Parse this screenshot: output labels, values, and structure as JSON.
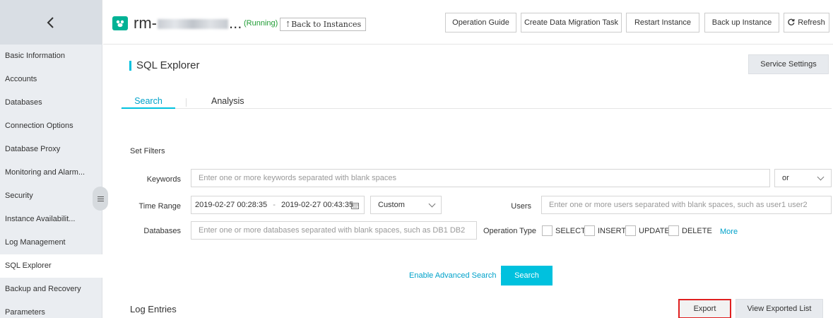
{
  "sidebar": {
    "items": [
      {
        "label": "Basic Information"
      },
      {
        "label": "Accounts"
      },
      {
        "label": "Databases"
      },
      {
        "label": "Connection Options"
      },
      {
        "label": "Database Proxy"
      },
      {
        "label": "Monitoring and Alarm..."
      },
      {
        "label": "Security"
      },
      {
        "label": "Instance Availabilit..."
      },
      {
        "label": "Log Management"
      },
      {
        "label": "SQL Explorer"
      },
      {
        "label": "Backup and Recovery"
      },
      {
        "label": "Parameters"
      }
    ],
    "active_item": "SQL Explorer"
  },
  "header": {
    "instance_prefix": "rm-",
    "instance_suffix": "...",
    "status": "(Running)",
    "back_to_instances": "⇡Back to Instances",
    "buttons": {
      "operation_guide": "Operation Guide",
      "create_migration": "Create Data Migration Task",
      "restart": "Restart Instance",
      "backup": "Back up Instance",
      "refresh": "Refresh"
    }
  },
  "page": {
    "title": "SQL Explorer",
    "service_settings": "Service Settings"
  },
  "tabs": [
    {
      "label": "Search"
    },
    {
      "label": "Analysis"
    }
  ],
  "active_tab": "Search",
  "filters": {
    "heading": "Set Filters",
    "keywords": {
      "label": "Keywords",
      "placeholder": "Enter one or more keywords separated with blank spaces",
      "logic_value": "or"
    },
    "time_range": {
      "label": "Time Range",
      "start": "2019-02-27 00:28:35",
      "separator": "-",
      "end": "2019-02-27 00:43:35",
      "mode": "Custom"
    },
    "users": {
      "label": "Users",
      "placeholder": "Enter one or more users separated with blank spaces, such as user1 user2"
    },
    "databases": {
      "label": "Databases",
      "placeholder": "Enter one or more databases separated with blank spaces, such as DB1 DB2"
    },
    "operation_type": {
      "label": "Operation Type",
      "options": [
        "SELECT",
        "INSERT",
        "UPDATE",
        "DELETE"
      ],
      "more": "More"
    }
  },
  "actions": {
    "advanced_search": "Enable Advanced Search",
    "search": "Search"
  },
  "log_entries": {
    "title": "Log Entries",
    "export": "Export",
    "view_exported": "View Exported List"
  }
}
